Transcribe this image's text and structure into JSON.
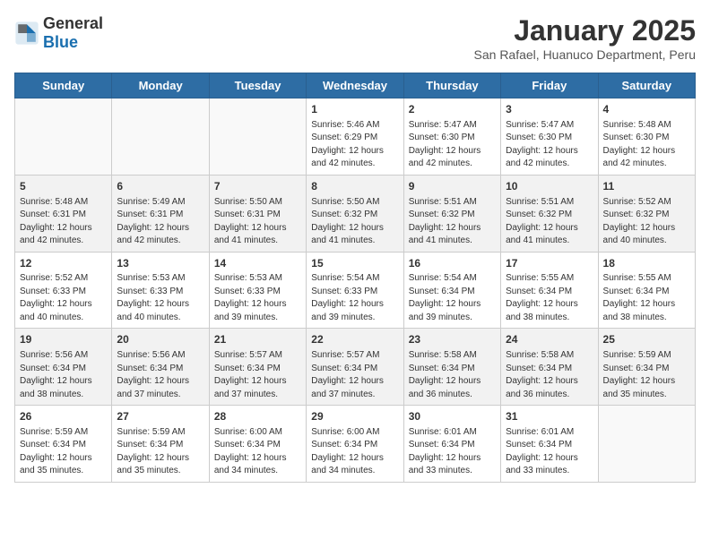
{
  "header": {
    "logo_general": "General",
    "logo_blue": "Blue",
    "title": "January 2025",
    "subtitle": "San Rafael, Huanuco Department, Peru"
  },
  "days_of_week": [
    "Sunday",
    "Monday",
    "Tuesday",
    "Wednesday",
    "Thursday",
    "Friday",
    "Saturday"
  ],
  "weeks": [
    [
      {
        "day": "",
        "info": ""
      },
      {
        "day": "",
        "info": ""
      },
      {
        "day": "",
        "info": ""
      },
      {
        "day": "1",
        "info": "Sunrise: 5:46 AM\nSunset: 6:29 PM\nDaylight: 12 hours\nand 42 minutes."
      },
      {
        "day": "2",
        "info": "Sunrise: 5:47 AM\nSunset: 6:30 PM\nDaylight: 12 hours\nand 42 minutes."
      },
      {
        "day": "3",
        "info": "Sunrise: 5:47 AM\nSunset: 6:30 PM\nDaylight: 12 hours\nand 42 minutes."
      },
      {
        "day": "4",
        "info": "Sunrise: 5:48 AM\nSunset: 6:30 PM\nDaylight: 12 hours\nand 42 minutes."
      }
    ],
    [
      {
        "day": "5",
        "info": "Sunrise: 5:48 AM\nSunset: 6:31 PM\nDaylight: 12 hours\nand 42 minutes."
      },
      {
        "day": "6",
        "info": "Sunrise: 5:49 AM\nSunset: 6:31 PM\nDaylight: 12 hours\nand 42 minutes."
      },
      {
        "day": "7",
        "info": "Sunrise: 5:50 AM\nSunset: 6:31 PM\nDaylight: 12 hours\nand 41 minutes."
      },
      {
        "day": "8",
        "info": "Sunrise: 5:50 AM\nSunset: 6:32 PM\nDaylight: 12 hours\nand 41 minutes."
      },
      {
        "day": "9",
        "info": "Sunrise: 5:51 AM\nSunset: 6:32 PM\nDaylight: 12 hours\nand 41 minutes."
      },
      {
        "day": "10",
        "info": "Sunrise: 5:51 AM\nSunset: 6:32 PM\nDaylight: 12 hours\nand 41 minutes."
      },
      {
        "day": "11",
        "info": "Sunrise: 5:52 AM\nSunset: 6:32 PM\nDaylight: 12 hours\nand 40 minutes."
      }
    ],
    [
      {
        "day": "12",
        "info": "Sunrise: 5:52 AM\nSunset: 6:33 PM\nDaylight: 12 hours\nand 40 minutes."
      },
      {
        "day": "13",
        "info": "Sunrise: 5:53 AM\nSunset: 6:33 PM\nDaylight: 12 hours\nand 40 minutes."
      },
      {
        "day": "14",
        "info": "Sunrise: 5:53 AM\nSunset: 6:33 PM\nDaylight: 12 hours\nand 39 minutes."
      },
      {
        "day": "15",
        "info": "Sunrise: 5:54 AM\nSunset: 6:33 PM\nDaylight: 12 hours\nand 39 minutes."
      },
      {
        "day": "16",
        "info": "Sunrise: 5:54 AM\nSunset: 6:34 PM\nDaylight: 12 hours\nand 39 minutes."
      },
      {
        "day": "17",
        "info": "Sunrise: 5:55 AM\nSunset: 6:34 PM\nDaylight: 12 hours\nand 38 minutes."
      },
      {
        "day": "18",
        "info": "Sunrise: 5:55 AM\nSunset: 6:34 PM\nDaylight: 12 hours\nand 38 minutes."
      }
    ],
    [
      {
        "day": "19",
        "info": "Sunrise: 5:56 AM\nSunset: 6:34 PM\nDaylight: 12 hours\nand 38 minutes."
      },
      {
        "day": "20",
        "info": "Sunrise: 5:56 AM\nSunset: 6:34 PM\nDaylight: 12 hours\nand 37 minutes."
      },
      {
        "day": "21",
        "info": "Sunrise: 5:57 AM\nSunset: 6:34 PM\nDaylight: 12 hours\nand 37 minutes."
      },
      {
        "day": "22",
        "info": "Sunrise: 5:57 AM\nSunset: 6:34 PM\nDaylight: 12 hours\nand 37 minutes."
      },
      {
        "day": "23",
        "info": "Sunrise: 5:58 AM\nSunset: 6:34 PM\nDaylight: 12 hours\nand 36 minutes."
      },
      {
        "day": "24",
        "info": "Sunrise: 5:58 AM\nSunset: 6:34 PM\nDaylight: 12 hours\nand 36 minutes."
      },
      {
        "day": "25",
        "info": "Sunrise: 5:59 AM\nSunset: 6:34 PM\nDaylight: 12 hours\nand 35 minutes."
      }
    ],
    [
      {
        "day": "26",
        "info": "Sunrise: 5:59 AM\nSunset: 6:34 PM\nDaylight: 12 hours\nand 35 minutes."
      },
      {
        "day": "27",
        "info": "Sunrise: 5:59 AM\nSunset: 6:34 PM\nDaylight: 12 hours\nand 35 minutes."
      },
      {
        "day": "28",
        "info": "Sunrise: 6:00 AM\nSunset: 6:34 PM\nDaylight: 12 hours\nand 34 minutes."
      },
      {
        "day": "29",
        "info": "Sunrise: 6:00 AM\nSunset: 6:34 PM\nDaylight: 12 hours\nand 34 minutes."
      },
      {
        "day": "30",
        "info": "Sunrise: 6:01 AM\nSunset: 6:34 PM\nDaylight: 12 hours\nand 33 minutes."
      },
      {
        "day": "31",
        "info": "Sunrise: 6:01 AM\nSunset: 6:34 PM\nDaylight: 12 hours\nand 33 minutes."
      },
      {
        "day": "",
        "info": ""
      }
    ]
  ]
}
